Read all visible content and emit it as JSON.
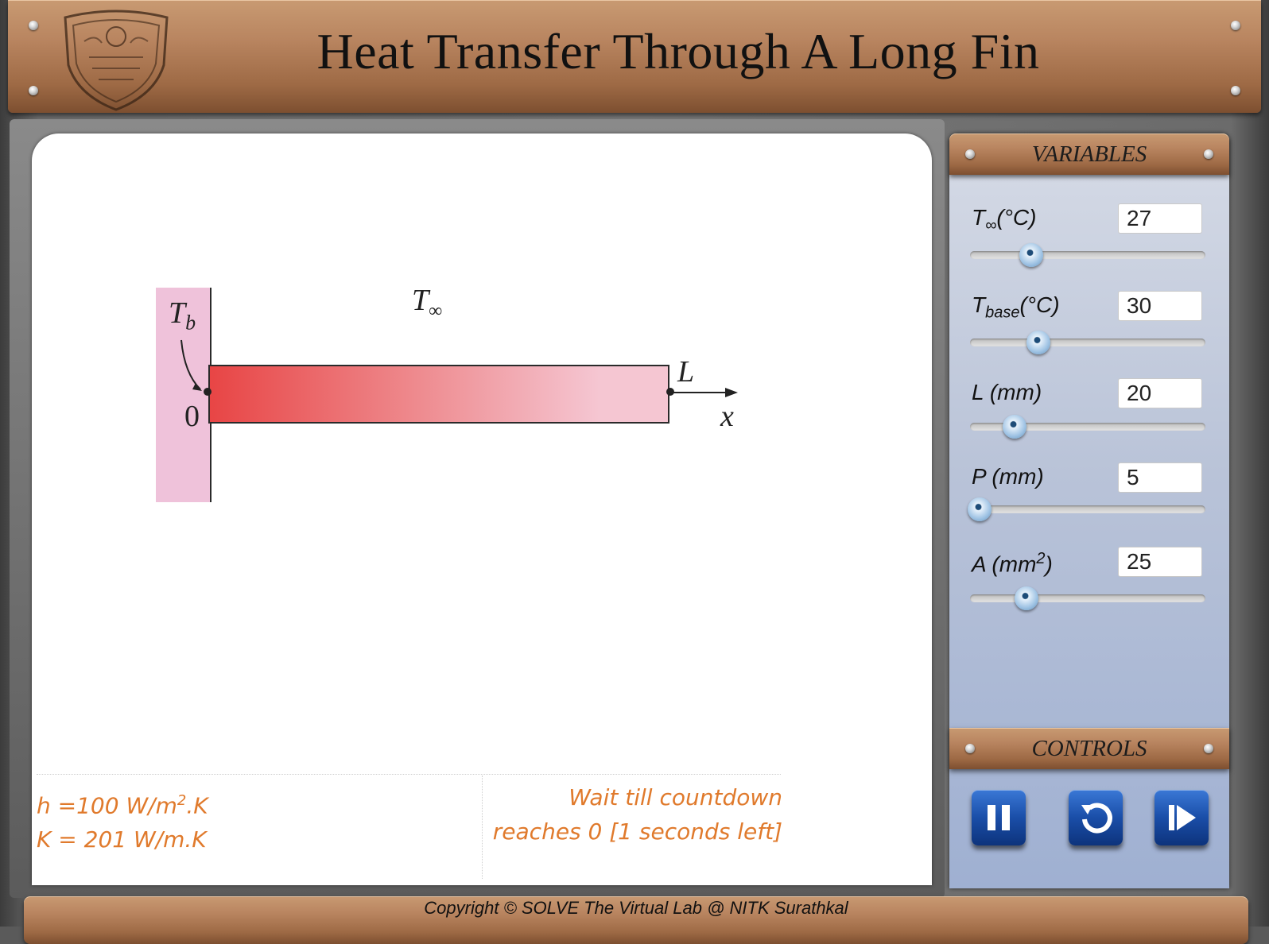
{
  "header": {
    "title": "Heat Transfer Through A Long Fin"
  },
  "diagram": {
    "base_temp_symbol": "T",
    "base_temp_sub": "b",
    "ambient_symbol": "T",
    "ambient_sub": "∞",
    "origin_label": "0",
    "length_label": "L",
    "axis_label": "x",
    "base_color": "#efc2da",
    "fin_color_hot": "#e84545",
    "fin_color_cold": "#f5c6d2"
  },
  "info": {
    "h_prefix": "h =100 W/m",
    "h_exp": "2",
    "h_suffix": ".K",
    "k_line": "K = 201 W/m.K",
    "status": "Wait till countdown reaches 0 [1 seconds left]",
    "text_color": "#e07a2c"
  },
  "variables": {
    "heading": "VARIABLES",
    "items": [
      {
        "label_main": "T",
        "label_sub": "∞",
        "label_unit": "(°C)",
        "value": "27",
        "slider_fraction": 0.26
      },
      {
        "label_main": "T",
        "label_sub": "base",
        "label_unit": "(°C)",
        "value": "30",
        "slider_fraction": 0.29
      },
      {
        "label_main": "L (mm)",
        "label_sub": "",
        "label_unit": "",
        "value": "20",
        "slider_fraction": 0.19
      },
      {
        "label_main": "P (mm)",
        "label_sub": "",
        "label_unit": "",
        "value": "5",
        "slider_fraction": 0.04
      },
      {
        "label_main": "A (mm",
        "label_sup": "2",
        "label_unit": ")",
        "value": "25",
        "slider_fraction": 0.24
      }
    ]
  },
  "controls": {
    "heading": "CONTROLS",
    "buttons": [
      {
        "name": "pause",
        "icon": "pause-icon"
      },
      {
        "name": "reset",
        "icon": "reset-icon"
      },
      {
        "name": "step",
        "icon": "step-forward-icon"
      }
    ]
  },
  "footer": {
    "text": "Copyright © SOLVE The Virtual Lab @ NITK Surathkal"
  }
}
